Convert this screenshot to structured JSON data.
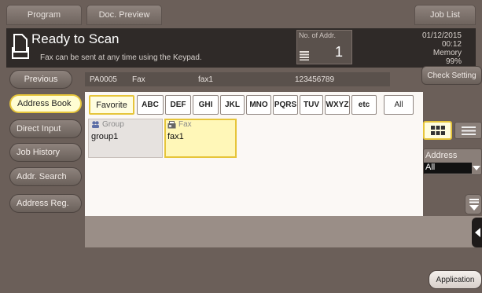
{
  "top_tabs": {
    "program": "Program",
    "doc_preview": "Doc. Preview",
    "job_list": "Job List"
  },
  "status": {
    "title": "Ready to Scan",
    "message": "Fax can be sent at any time using the Keypad.",
    "addr_label": "No. of Addr.",
    "addr_count": "1",
    "date": "01/12/2015",
    "time": "00:12",
    "memory_label": "Memory",
    "memory_value": "99%"
  },
  "previous_button": "Previous",
  "destination": {
    "id": "PA0005",
    "type": "Fax",
    "name": "fax1",
    "number": "123456789"
  },
  "check_setting": "Check Setting",
  "nav": {
    "address_book": "Address Book",
    "direct_input": "Direct Input",
    "job_history": "Job History",
    "addr_search": "Addr. Search",
    "address_reg": "Address Reg."
  },
  "index_tabs": [
    "Favorite",
    "ABC",
    "DEF",
    "GHI",
    "JKL",
    "MNO",
    "PQRS",
    "TUV",
    "WXYZ",
    "etc",
    "All"
  ],
  "cards": [
    {
      "type": "Group",
      "name": "group1"
    },
    {
      "type": "Fax",
      "name": "fax1"
    }
  ],
  "address_filter": {
    "label": "Address",
    "value": "All"
  },
  "application": "Application"
}
